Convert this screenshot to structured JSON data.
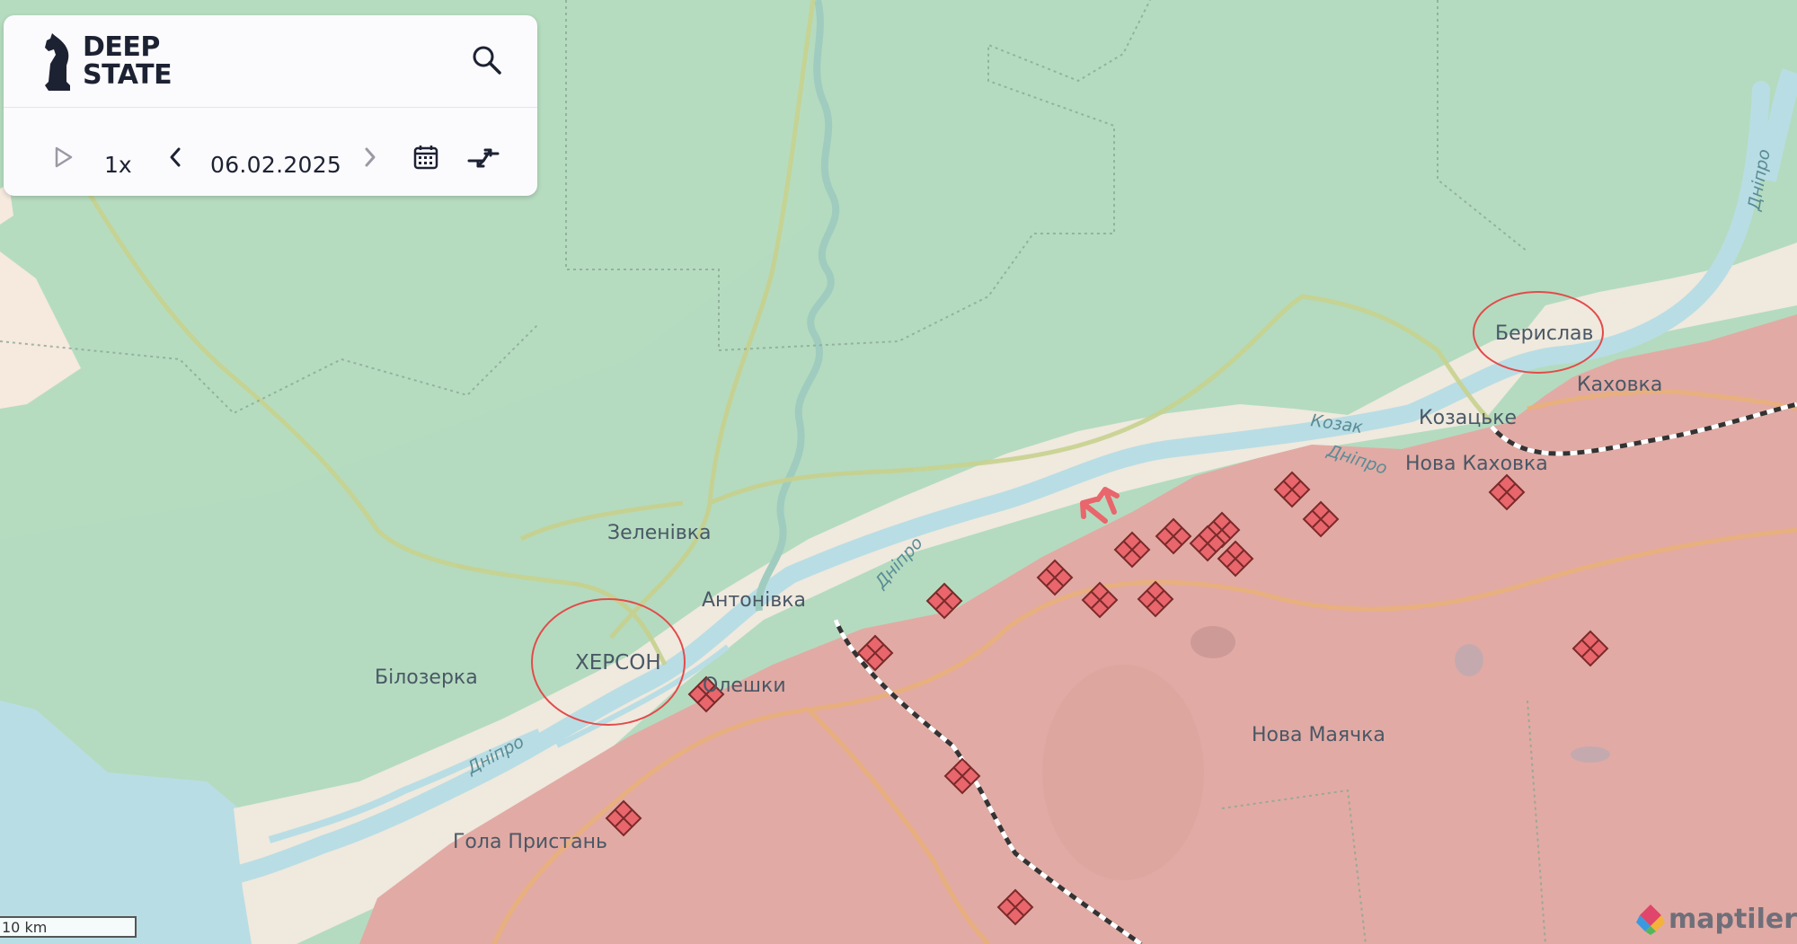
{
  "logo": {
    "line1": "DEEP",
    "line2": "STATE"
  },
  "toolbar": {
    "speed": "1x",
    "date": "06.02.2025"
  },
  "labels": {
    "kherson": "ХЕРСОН",
    "bilozerka": "Білозерка",
    "zelenivka": "Зеленівка",
    "antonivka": "Антонівка",
    "oleshky": "Олешки",
    "hola_prystan": "Гола Пристань",
    "beryslav": "Берислав",
    "kakhovka": "Каховка",
    "kozatske": "Козацьке",
    "nova_kakhovka": "Нова Каховка",
    "nova_maiachka": "Нова Маячка",
    "river_dnipro": "Дніпро",
    "river_kozak": "Козак"
  },
  "scale_label": "10 km",
  "attribution": "maptiler",
  "colors": {
    "free_territory": "#b4dbbf",
    "occupied": "#e2aaa4",
    "grey_zone": "#efe9de",
    "water": "#b9dde4",
    "marker": "#e8666c"
  }
}
